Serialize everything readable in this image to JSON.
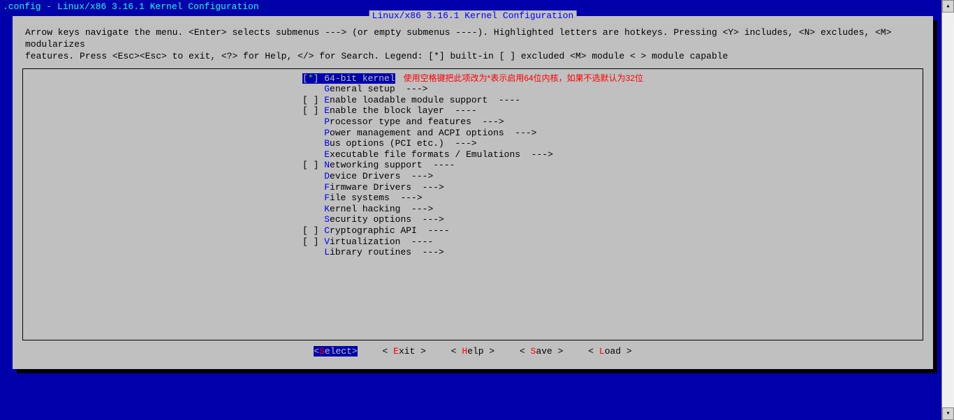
{
  "titleBar": ".config - Linux/x86 3.16.1 Kernel Configuration",
  "panelTitle": "Linux/x86 3.16.1 Kernel Configuration",
  "helpLine1": "Arrow keys navigate the menu.  <Enter> selects submenus ---> (or empty submenus ----).  Highlighted letters are hotkeys.  Pressing <Y> includes, <N> excludes, <M> modularizes",
  "helpLine2": "features.  Press <Esc><Esc> to exit, <?> for Help, </> for Search.  Legend: [*] built-in  [ ] excluded  <M> module  < > module capable",
  "annotation": "使用空格键把此项改为*表示启用64位内核，如果不选默认为32位",
  "menu": [
    {
      "bracket": "[",
      "mark": "*",
      "bracketEnd": "]",
      "hotkey": "6",
      "label": "4-bit kernel",
      "suffix": "",
      "selected": true
    },
    {
      "bracket": " ",
      "mark": " ",
      "bracketEnd": " ",
      "hotkey": "G",
      "label": "eneral setup",
      "suffix": "  --->"
    },
    {
      "bracket": "[",
      "mark": " ",
      "bracketEnd": "]",
      "hotkey": "E",
      "label": "nable loadable module support",
      "suffix": "  ----"
    },
    {
      "bracket": "[",
      "mark": " ",
      "bracketEnd": "]",
      "hotkey": "E",
      "label": "nable the block layer",
      "suffix": "  ----"
    },
    {
      "bracket": " ",
      "mark": " ",
      "bracketEnd": " ",
      "hotkey": "P",
      "label": "rocessor type and features",
      "suffix": "  --->"
    },
    {
      "bracket": " ",
      "mark": " ",
      "bracketEnd": " ",
      "hotkey": "P",
      "label": "ower management and ACPI options",
      "suffix": "  --->"
    },
    {
      "bracket": " ",
      "mark": " ",
      "bracketEnd": " ",
      "hotkey": "B",
      "label": "us options (PCI etc.)",
      "suffix": "  --->"
    },
    {
      "bracket": " ",
      "mark": " ",
      "bracketEnd": " ",
      "hotkey": "E",
      "label": "xecutable file formats / Emulations",
      "suffix": "  --->"
    },
    {
      "bracket": "[",
      "mark": " ",
      "bracketEnd": "]",
      "hotkey": "N",
      "label": "etworking support",
      "suffix": "  ----"
    },
    {
      "bracket": " ",
      "mark": " ",
      "bracketEnd": " ",
      "hotkey": "D",
      "label": "evice Drivers",
      "suffix": "  --->"
    },
    {
      "bracket": " ",
      "mark": " ",
      "bracketEnd": " ",
      "hotkey": "F",
      "label": "irmware Drivers",
      "suffix": "  --->"
    },
    {
      "bracket": " ",
      "mark": " ",
      "bracketEnd": " ",
      "hotkey": "F",
      "label": "ile systems",
      "suffix": "  --->"
    },
    {
      "bracket": " ",
      "mark": " ",
      "bracketEnd": " ",
      "hotkey": "K",
      "label": "ernel hacking",
      "suffix": "  --->"
    },
    {
      "bracket": " ",
      "mark": " ",
      "bracketEnd": " ",
      "hotkey": "S",
      "label": "ecurity options",
      "suffix": "  --->"
    },
    {
      "bracket": "[",
      "mark": " ",
      "bracketEnd": "]",
      "hotkey": "C",
      "label": "ryptographic API",
      "suffix": "  ----"
    },
    {
      "bracket": "[",
      "mark": " ",
      "bracketEnd": "]",
      "hotkey": "V",
      "label": "irtualization",
      "suffix": "  ----"
    },
    {
      "bracket": " ",
      "mark": " ",
      "bracketEnd": " ",
      "hotkey": "L",
      "label": "ibrary routines",
      "suffix": "  --->"
    }
  ],
  "buttons": {
    "select": {
      "pre": "<",
      "hk": "S",
      "rest": "elect>",
      "active": true
    },
    "exit": {
      "pre": "< ",
      "hk": "E",
      "rest": "xit >"
    },
    "help": {
      "pre": "< ",
      "hk": "H",
      "rest": "elp >"
    },
    "save": {
      "pre": "< ",
      "hk": "S",
      "rest": "ave >"
    },
    "load": {
      "pre": "< ",
      "hk": "L",
      "rest": "oad >"
    }
  }
}
